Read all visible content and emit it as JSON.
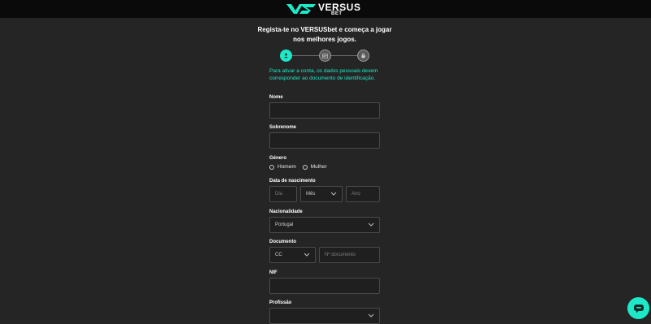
{
  "brand": {
    "name": "VERSUS",
    "sub": "BET",
    "color": "#1de9c8"
  },
  "form": {
    "headline": "Regista-te no VERSUSbet e começa a jogar nos melhores jogos.",
    "steps": [
      {
        "icon": "user-icon",
        "active": true
      },
      {
        "icon": "id-card-icon",
        "active": false
      },
      {
        "icon": "lock-icon",
        "active": false
      }
    ],
    "info": "Para ativar a conta, os dados pessoais devem corresponder ao documento de identificação.",
    "nome_label": "Nome",
    "sobrenome_label": "Sobrenome",
    "genero_label": "Género",
    "genero_options": [
      "Homem",
      "Mulher"
    ],
    "nascimento_label": "Data de nascimento",
    "dia_placeholder": "Dia",
    "mes_value": "Mês",
    "ano_placeholder": "Ano",
    "nacionalidade_label": "Nacionalidade",
    "nacionalidade_value": "Portugal",
    "documento_label": "Documento",
    "documento_type": "CC",
    "documento_placeholder": "Nº documento",
    "nif_label": "NIF",
    "profissao_label": "Profissão"
  },
  "chat": {
    "icon": "chat-icon"
  }
}
